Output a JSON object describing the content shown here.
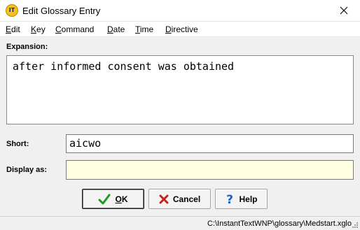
{
  "window": {
    "title": "Edit Glossary Entry",
    "icon": "instanttext-app-icon",
    "icon_text": "IT"
  },
  "menu": {
    "items": [
      {
        "label": "Edit",
        "accel": "E",
        "rest": "dit"
      },
      {
        "label": "Key",
        "accel": "K",
        "rest": "ey"
      },
      {
        "label": "Command",
        "accel": "C",
        "rest": "ommand"
      },
      {
        "label": "Date",
        "accel": "D",
        "rest": "ate"
      },
      {
        "label": "Time",
        "accel": "T",
        "rest": "ime"
      },
      {
        "label": "Directive",
        "accel": "D",
        "rest": "irective"
      }
    ]
  },
  "form": {
    "expansion_label": "Expansion:",
    "expansion_value": "after informed consent was obtained",
    "short_label": "Short:",
    "short_value": "aicwo",
    "display_label": "Display as:",
    "display_value": ""
  },
  "buttons": {
    "ok": {
      "accel": "O",
      "rest": "K",
      "icon": "checkmark-icon"
    },
    "cancel": {
      "label": "Cancel",
      "icon": "x-icon"
    },
    "help": {
      "label": "Help",
      "icon": "question-icon"
    }
  },
  "status": {
    "path": "C:\\InstantTextWNP\\glossary\\Medstart.xglo"
  },
  "colors": {
    "display_field_bg": "#ffffe1",
    "ok_check": "#1a9e1a",
    "cancel_x": "#c81e1e",
    "help_q": "#1c5fc8"
  }
}
